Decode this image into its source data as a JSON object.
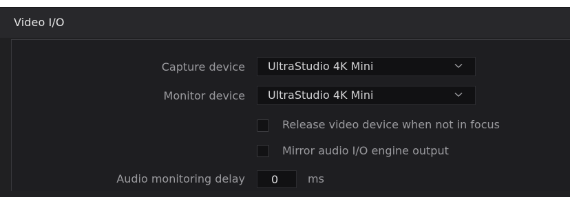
{
  "panel": {
    "title": "Video I/O"
  },
  "capture_device": {
    "label": "Capture device",
    "value": "UltraStudio 4K Mini"
  },
  "monitor_device": {
    "label": "Monitor device",
    "value": "UltraStudio 4K Mini"
  },
  "checkboxes": [
    {
      "label": "Release video device when not in focus",
      "checked": false
    },
    {
      "label": "Mirror audio I/O engine output",
      "checked": false
    }
  ],
  "audio_monitoring_delay": {
    "label": "Audio monitoring delay",
    "value": "0",
    "unit": "ms"
  },
  "colors": {
    "panel_bg": "#202022",
    "header_bg": "#28282b",
    "field_bg": "#111113",
    "label_text": "#9a9a9e",
    "value_text": "#d2d2d4"
  },
  "icons": {
    "dropdown_arrow": "chevron-down-icon"
  }
}
